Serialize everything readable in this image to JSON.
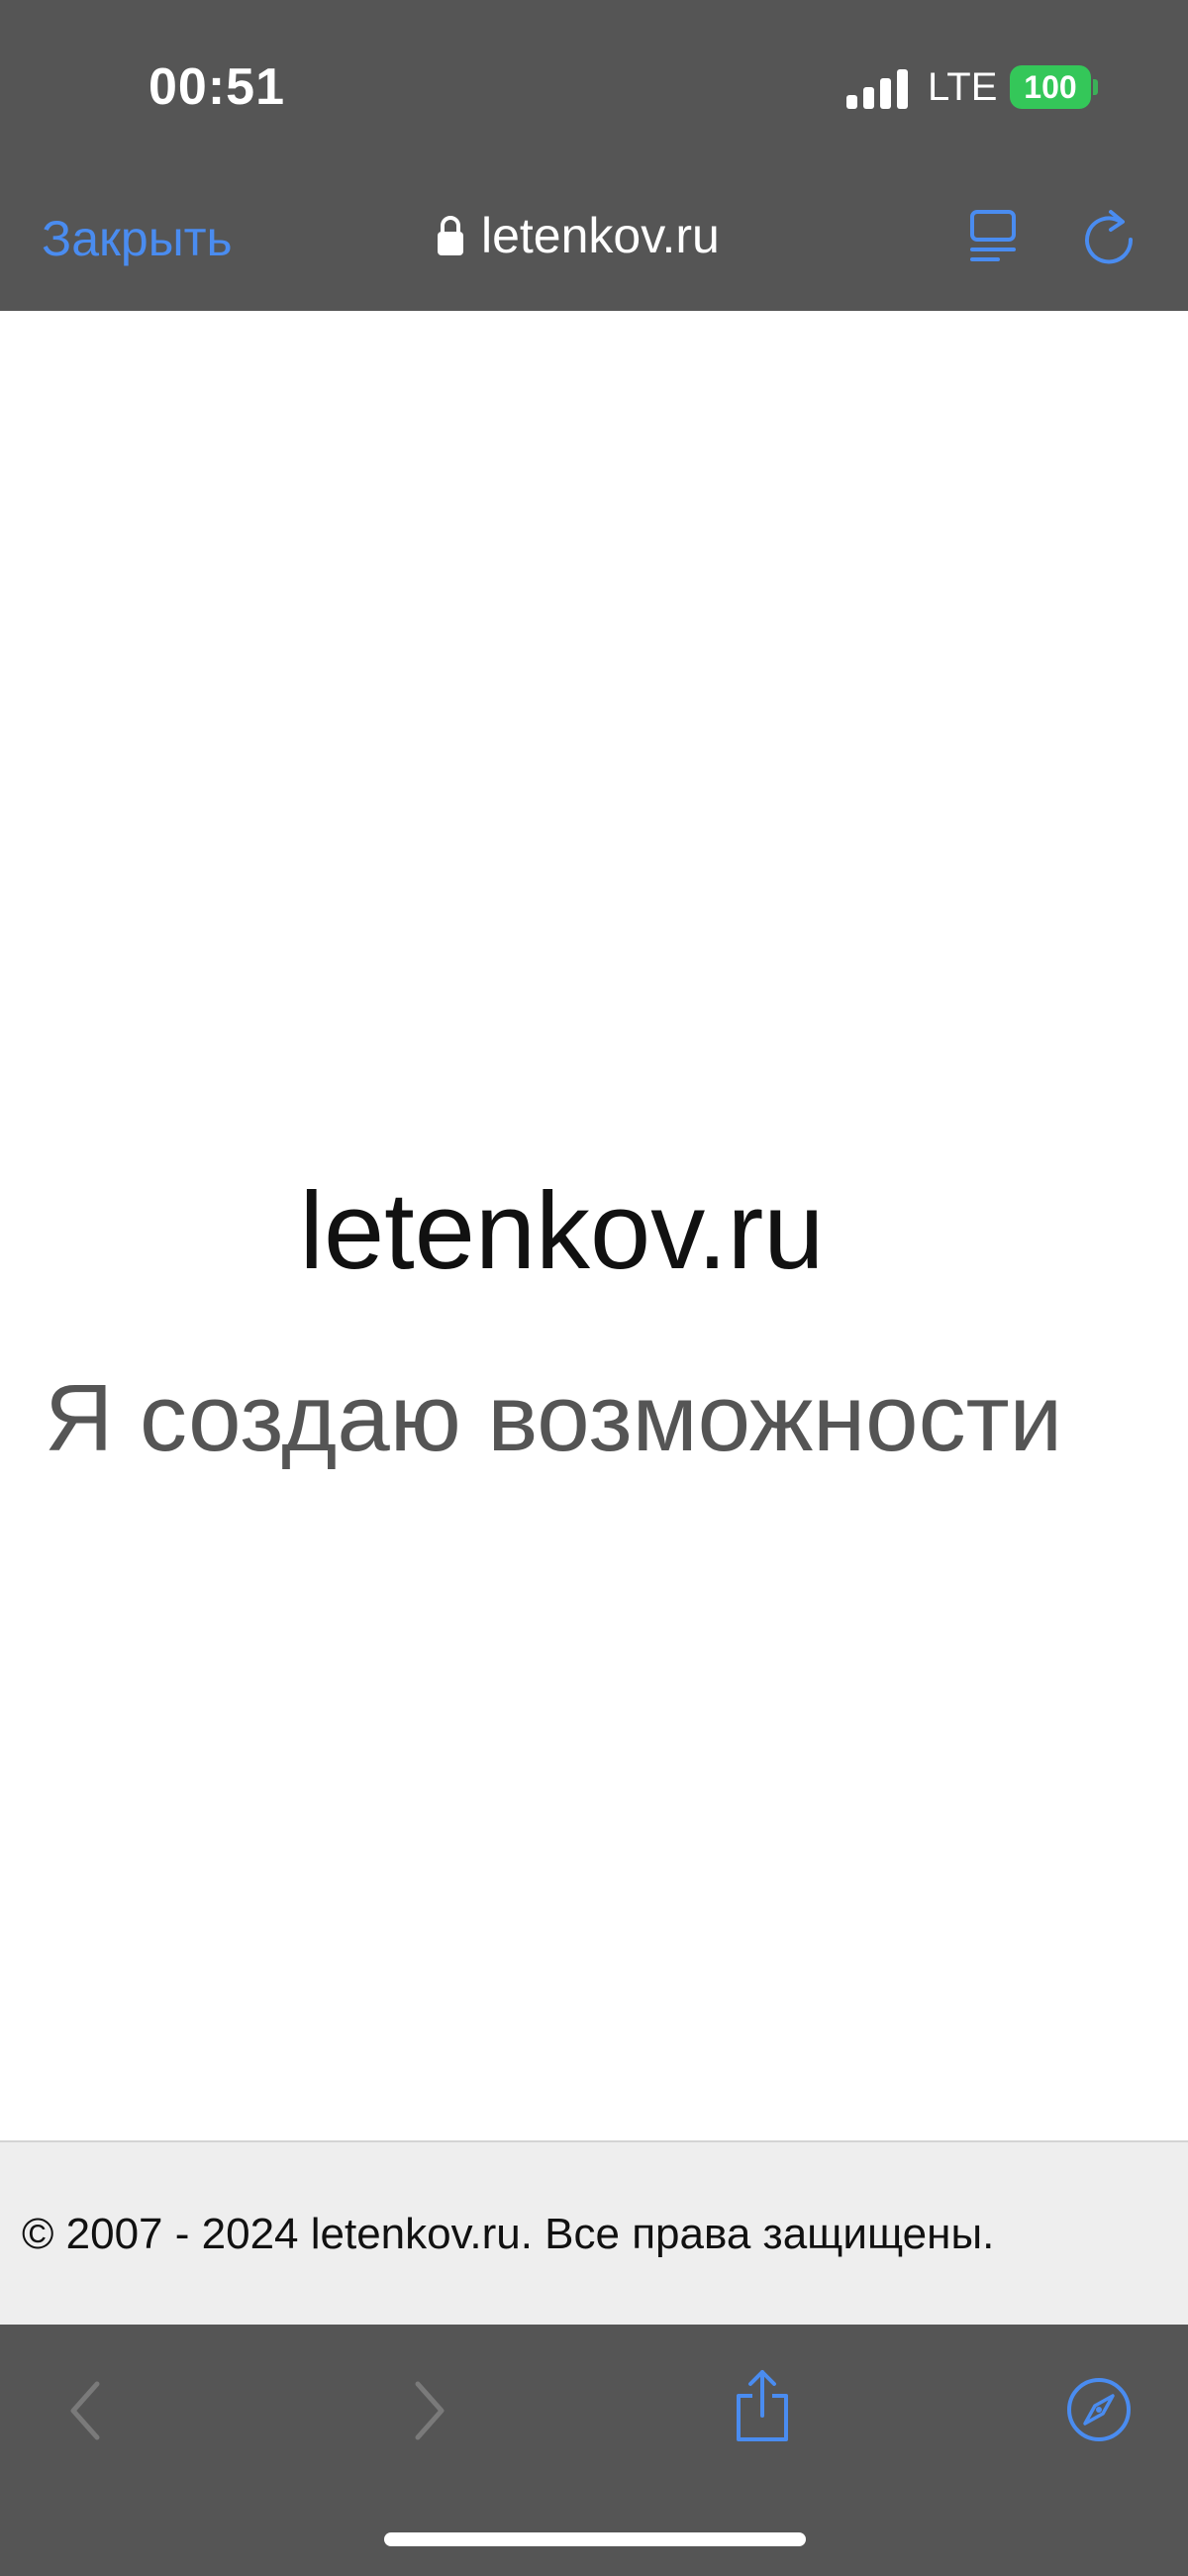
{
  "status_bar": {
    "time": "00:51",
    "network": "LTE",
    "battery": "100"
  },
  "nav_bar": {
    "close_label": "Закрыть",
    "url": "letenkov.ru"
  },
  "page": {
    "title": "letenkov.ru",
    "tagline": "Я создаю возможности",
    "footer": "© 2007 - 2024 letenkov.ru. Все права защищены."
  },
  "colors": {
    "chrome_bg": "#555555",
    "accent_blue": "#4a8cf0",
    "battery_green": "#34c759",
    "footer_bg": "#eeeeee"
  },
  "icons": {
    "lock": "lock-icon",
    "reader": "reader-mode-icon",
    "reload": "reload-icon",
    "back": "chevron-left-icon",
    "forward": "chevron-right-icon",
    "share": "share-icon",
    "safari": "compass-icon"
  }
}
